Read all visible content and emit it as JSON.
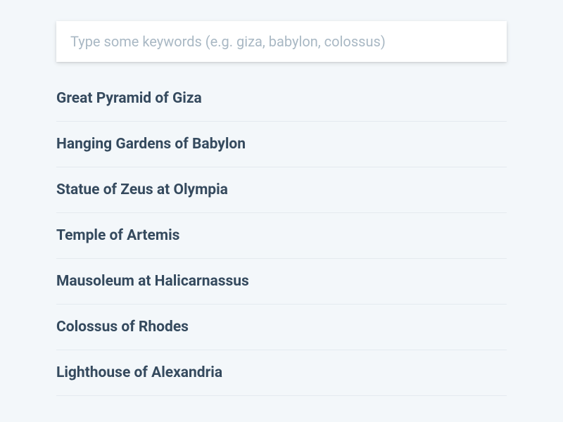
{
  "search": {
    "value": "",
    "placeholder": "Type some keywords (e.g. giza, babylon, colossus)"
  },
  "results": [
    {
      "title": "Great Pyramid of Giza"
    },
    {
      "title": "Hanging Gardens of Babylon"
    },
    {
      "title": "Statue of Zeus at Olympia"
    },
    {
      "title": "Temple of Artemis"
    },
    {
      "title": "Mausoleum at Halicarnassus"
    },
    {
      "title": "Colossus of Rhodes"
    },
    {
      "title": "Lighthouse of Alexandria"
    }
  ]
}
